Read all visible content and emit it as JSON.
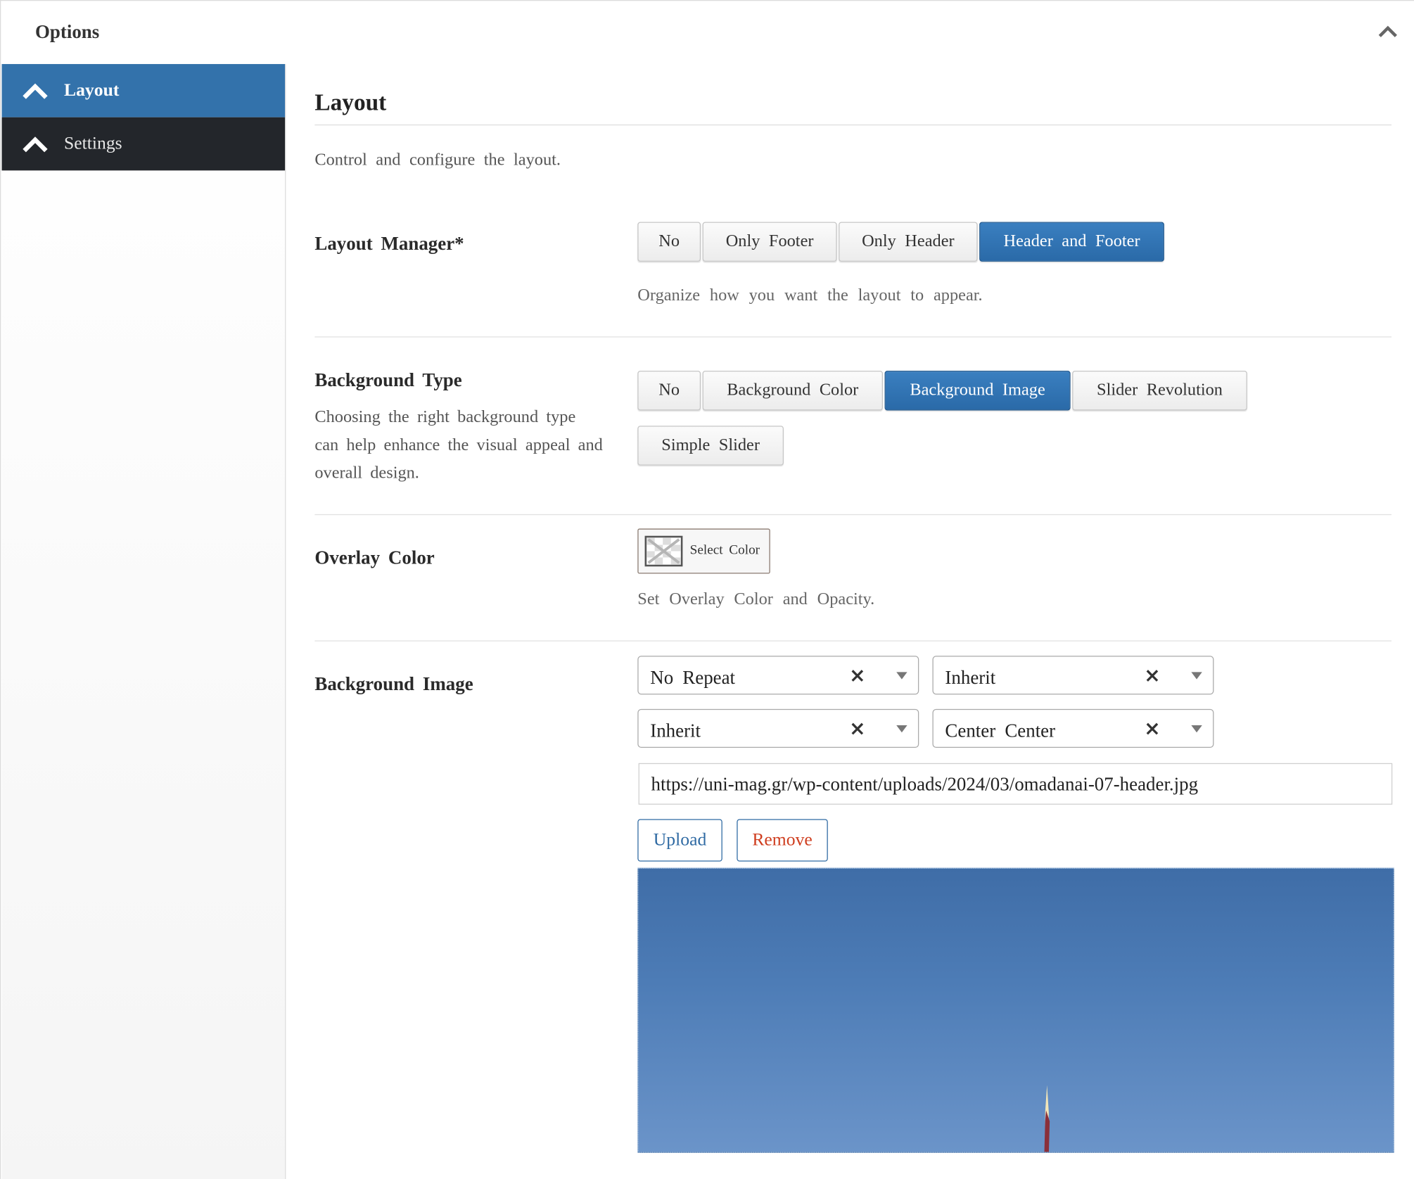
{
  "panel": {
    "title": "Options"
  },
  "sidebar": {
    "items": [
      {
        "label": "Layout",
        "active": true
      },
      {
        "label": "Settings",
        "active": false
      }
    ]
  },
  "section": {
    "title": "Layout",
    "description": "Control and configure the layout."
  },
  "layout_manager": {
    "label": "Layout Manager*",
    "options": [
      "No",
      "Only Footer",
      "Only Header",
      "Header and Footer"
    ],
    "selected": "Header and Footer",
    "help": "Organize how you want the layout to appear."
  },
  "background_type": {
    "label": "Background Type",
    "description": "Choosing the right background type can help enhance the visual appeal and overall design.",
    "options": [
      "No",
      "Background Color",
      "Background Image",
      "Slider Revolution",
      "Simple Slider"
    ],
    "selected": "Background Image"
  },
  "overlay_color": {
    "label": "Overlay Color",
    "button_label": "Select Color",
    "help": "Set Overlay Color and Opacity."
  },
  "background_image": {
    "label": "Background Image",
    "repeat": "No Repeat",
    "attachment": "Inherit",
    "size": "Inherit",
    "position": "Center Center",
    "url": "https://uni-mag.gr/wp-content/uploads/2024/03/omadanai-07-header.jpg",
    "upload_label": "Upload",
    "remove_label": "Remove"
  },
  "colors": {
    "accent": "#3372ab",
    "sidebar_dark": "#23262b",
    "remove": "#cf3e1f"
  },
  "icons": {
    "collapse": "chevron-up-icon",
    "sidebar": "chevron-up-icon",
    "clear": "close-icon",
    "dropdown": "caret-down-icon",
    "color_swatch": "transparent-swatch-icon"
  }
}
